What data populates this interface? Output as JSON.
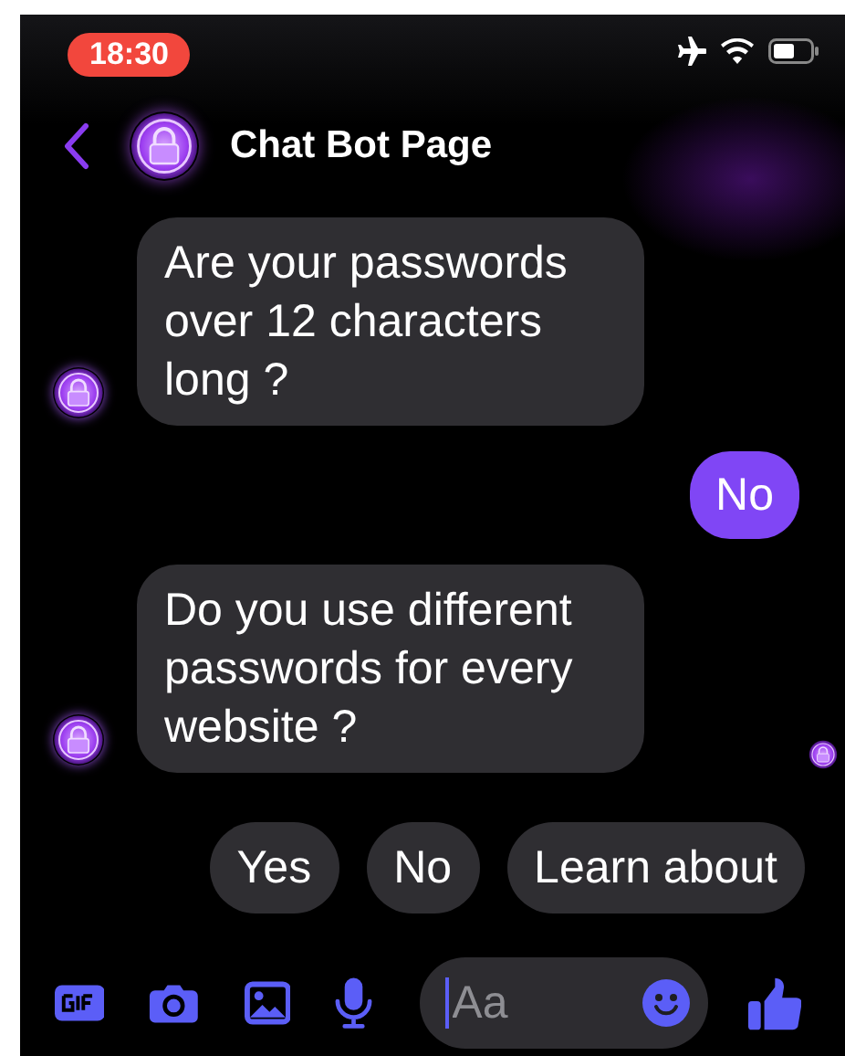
{
  "status_bar": {
    "time": "18:30"
  },
  "header": {
    "title": "Chat Bot Page"
  },
  "messages": [
    {
      "kind": "received",
      "text": "Are your passwords over 12 characters long ?",
      "seen": false
    },
    {
      "kind": "sent",
      "text": "No",
      "seen": false
    },
    {
      "kind": "received",
      "text": "Do you use different passwords for every website ?",
      "seen": true
    }
  ],
  "quick_replies": [
    "Yes",
    "No",
    "Learn about"
  ],
  "composer": {
    "placeholder": "Aa"
  }
}
